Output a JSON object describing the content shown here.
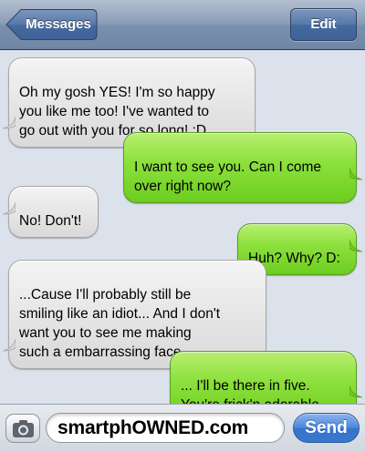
{
  "navbar": {
    "back_label": "Messages",
    "edit_label": "Edit"
  },
  "messages": [
    {
      "from": "them",
      "text": "Oh my gosh YES! I'm so happy\nyou like me too! I've wanted to\ngo out with you for so long! :D"
    },
    {
      "from": "me",
      "text": "I want to see you. Can I come\nover right now?"
    },
    {
      "from": "them",
      "text": "No! Don't!"
    },
    {
      "from": "me",
      "text": "Huh? Why? D:"
    },
    {
      "from": "them",
      "text": "...Cause I'll probably still be\nsmiling like an idiot... And I don't\nwant you to see me making\nsuch a embarrassing face…"
    },
    {
      "from": "me",
      "text": "... I'll be there in five.\nYou're frick'n adorable."
    }
  ],
  "input": {
    "value": "smartphOWNED.com",
    "send_label": "Send",
    "camera_icon": "camera-icon"
  },
  "colors": {
    "navbar": "#7b90ad",
    "incoming_bubble": "#e6e6e6",
    "outgoing_bubble": "#8ee13e",
    "send_button": "#4a87dc",
    "background": "#dbe2ec"
  }
}
